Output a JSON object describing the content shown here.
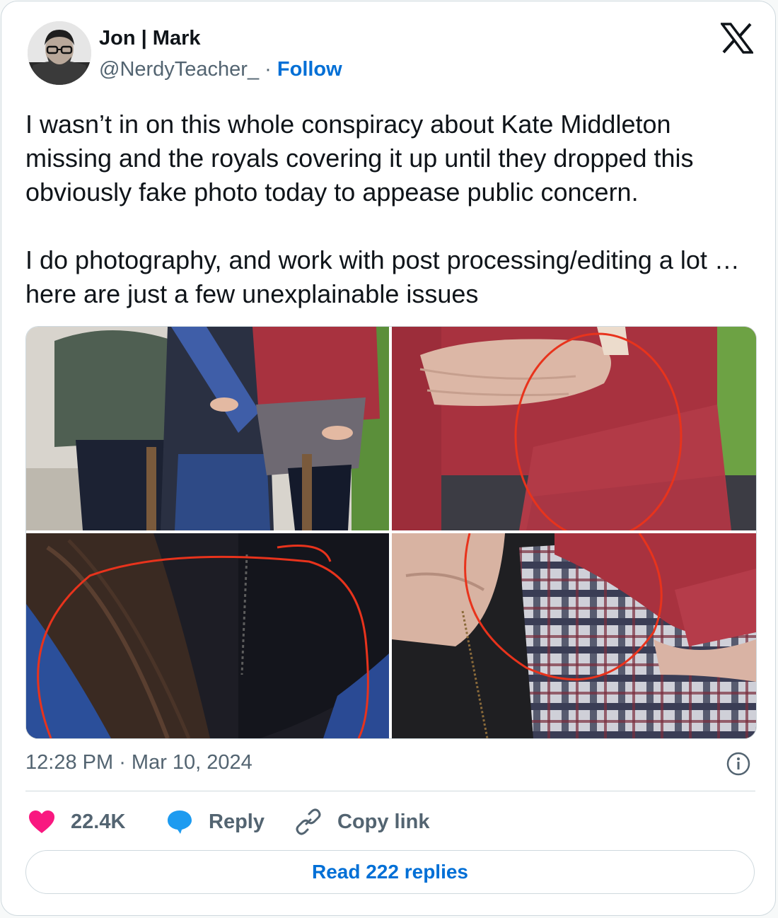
{
  "author": {
    "name": "Jon | Mark",
    "handle": "@NerdyTeacher_",
    "separator": " · ",
    "follow_label": "Follow"
  },
  "tweet": {
    "text": "I wasn’t in on this whole conspiracy about Kate Middleton missing and the royals covering it up until they dropped this obviously fake photo today to appease public concern.\n\nI do photography, and work with post processing/editing a lot … here are just a few unexplainable issues"
  },
  "timestamp": {
    "time": "12:28 PM",
    "separator": " · ",
    "date": "Mar 10, 2024"
  },
  "actions": {
    "likes": "22.4K",
    "reply_label": "Reply",
    "copy_link_label": "Copy link"
  },
  "read_replies_label": "Read 222 replies",
  "icons": {
    "platform": "x-logo-icon",
    "info": "info-icon",
    "like": "heart-icon",
    "reply": "speech-bubble-icon",
    "copy": "link-icon"
  },
  "colors": {
    "heart": "#f91880",
    "reply_bubble": "#1d9bf0",
    "link": "#006fd6",
    "annotation_circle": "#e8331c",
    "cardigan": "#a8323f"
  }
}
